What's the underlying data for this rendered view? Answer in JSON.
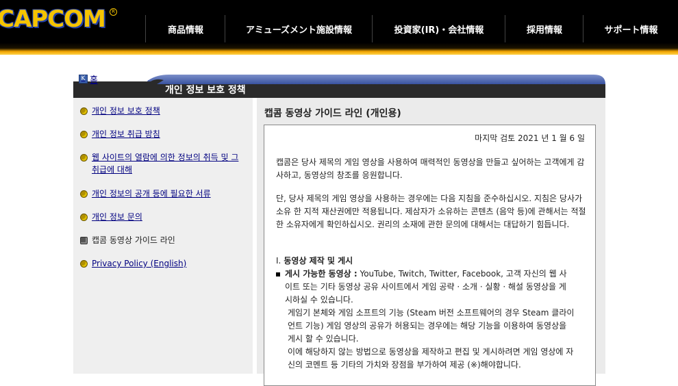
{
  "header": {
    "logo": "CAPCOM",
    "reg_mark": "R",
    "nav": [
      {
        "label": "商品情報"
      },
      {
        "label": "アミューズメント施設情報"
      },
      {
        "label": "投資家(IR)・会社情報"
      },
      {
        "label": "採用情報"
      },
      {
        "label": "サポート情報"
      }
    ]
  },
  "breadcrumb": {
    "home_label": "홈",
    "home_icon": "K"
  },
  "page_title": "개인 정보 보호 정책",
  "sidebar": {
    "items": [
      {
        "label": "개인 정보 보호 정책",
        "link": true
      },
      {
        "label": "개인 정보 취급 방침",
        "link": true
      },
      {
        "label": "웹 사이트의 열람에 의한 정보의 취득 및 그 취급에 대해",
        "link": true
      },
      {
        "label": "개인 정보의 공개 등에 필요한 서류",
        "link": true
      },
      {
        "label": "개인 정보 문의",
        "link": true
      },
      {
        "label": "캡콤 동영상 가이드 라인",
        "link": false
      },
      {
        "label": "Privacy Policy (English)",
        "link": true
      }
    ]
  },
  "main": {
    "title": "캡콤 동영상 가이드 라인 (개인용)",
    "date": "마지막 검토 2021 년 1 월 6 일",
    "intro": "캡콤은 당사 제목의 게임 영상을 사용하여 매력적인 동영상을 만들고 싶어하는 고객에게 감사하고, 동영상의 창조를 응원합니다.",
    "para2": "단, 당사 제목의 게임 영상을 사용하는 경우에는 다음 지침을 준수하십시오. 지침은 당사가 소유 한 지적 재산권에만 적용됩니다. 제삼자가 소유하는 콘텐츠 (음악 등)에 관해서는 적절한 소유자에게 확인하십시오. 권리의 소재에 관한 문의에 대해서는 대답하기 힘듭니다.",
    "section1": {
      "num": "I.",
      "title": "동영상 제작 및 게시"
    },
    "item1": {
      "label": "게시 가능한 동영상 :",
      "text": " YouTube, Twitch, Twitter, Facebook, 고객 자신의 웹 사이트 또는 기타 동영상 공유 사이트에서 게임 공략 · 소개 · 실황 · 해설 동영상을 게시하실 수 있습니다."
    },
    "cont1": "게임기 본체와 게임 소프트의 기능 (Steam 버전 소프트웨어의 경우 Steam 클라이언트 기능) 게임 영상의 공유가 허용되는 경우에는 해당 기능을 이용하여 동영상을 게시 할 수 있습니다.",
    "cont2": "이에 해당하지 않는 방법으로 동영상을 제작하고 편집 및 게시하려면 게임 영상에 자신의 코멘트 등 기타의 가치와 장점을 부가하여 제공 (※)해야합니다."
  }
}
